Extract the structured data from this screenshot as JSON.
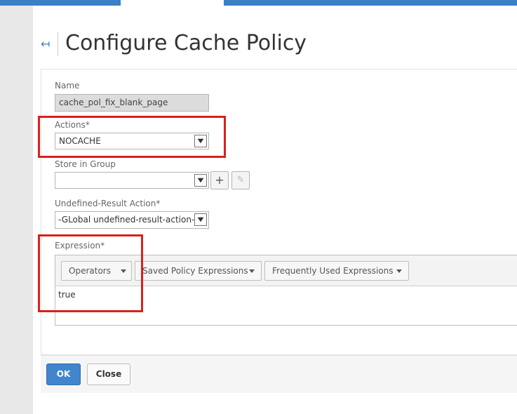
{
  "page": {
    "title": "Configure Cache Policy"
  },
  "form": {
    "name": {
      "label": "Name",
      "value": "cache_pol_fix_blank_page"
    },
    "actions": {
      "label": "Actions*",
      "value": "NOCACHE"
    },
    "store_in_group": {
      "label": "Store in Group",
      "value": ""
    },
    "undefined_result_action": {
      "label": "Undefined-Result Action*",
      "value": "-GLobal undefined-result-action-"
    },
    "expression": {
      "label": "Expression*",
      "toolbar": {
        "operators": "Operators",
        "saved_policy_expressions": "Saved Policy Expressions",
        "frequently_used_expressions": "Frequently Used Expressions"
      },
      "value": "true"
    }
  },
  "buttons": {
    "ok": "OK",
    "close": "Close"
  },
  "icons": {
    "back": "back-arrow-icon",
    "add": "plus-icon",
    "edit": "pencil-icon"
  },
  "colors": {
    "accent": "#3b7fc4",
    "highlight": "#d9211c",
    "ok_button": "#3f86cc"
  }
}
